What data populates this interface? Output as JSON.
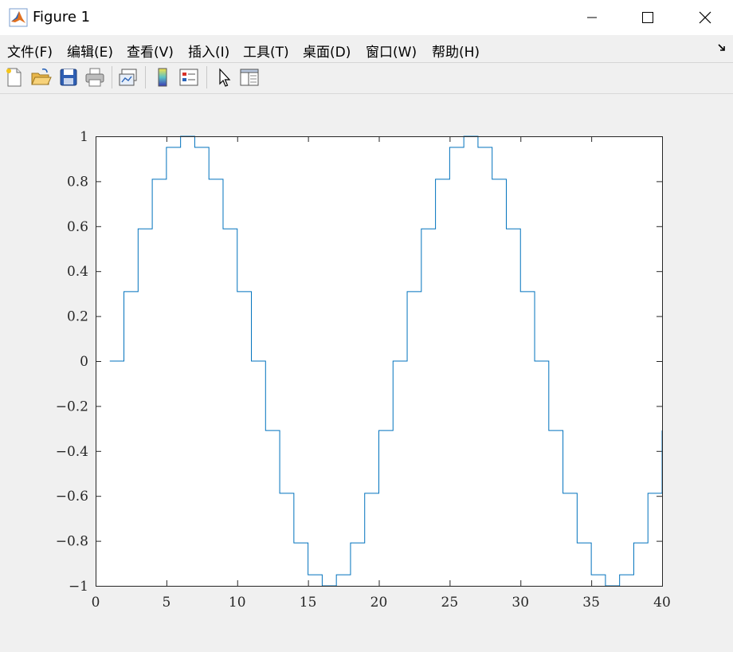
{
  "window": {
    "title": "Figure 1",
    "controls": [
      "minimize",
      "maximize",
      "close"
    ]
  },
  "menu": {
    "items": [
      "文件(F)",
      "编辑(E)",
      "查看(V)",
      "插入(I)",
      "工具(T)",
      "桌面(D)",
      "窗口(W)",
      "帮助(H)"
    ]
  },
  "toolbar": {
    "buttons": [
      "new-figure-icon",
      "open-file-icon",
      "save-icon",
      "print-icon",
      "link-plot-icon",
      "colorbar-icon",
      "legend-icon",
      "edit-pointer-icon",
      "property-inspector-icon"
    ]
  },
  "colors": {
    "line": "#0072bd",
    "background": "#f0f0f0",
    "axes_background": "#ffffff"
  },
  "chart_data": {
    "type": "line",
    "style": "stairs",
    "x": [
      1,
      2,
      3,
      4,
      5,
      6,
      7,
      8,
      9,
      10,
      11,
      12,
      13,
      14,
      15,
      16,
      17,
      18,
      19,
      20,
      21,
      22,
      23,
      24,
      25,
      26,
      27,
      28,
      29,
      30,
      31,
      32,
      33,
      34,
      35,
      36,
      37,
      38,
      39,
      40
    ],
    "values": [
      0,
      0.309,
      0.588,
      0.809,
      0.951,
      1,
      0.951,
      0.809,
      0.588,
      0.309,
      0,
      -0.309,
      -0.588,
      -0.809,
      -0.951,
      -1,
      -0.951,
      -0.809,
      -0.588,
      -0.309,
      0,
      0.309,
      0.588,
      0.809,
      0.951,
      1,
      0.951,
      0.809,
      0.588,
      0.309,
      0,
      -0.309,
      -0.588,
      -0.809,
      -0.951,
      -1,
      -0.951,
      -0.809,
      -0.588,
      -0.309
    ],
    "xlim": [
      0,
      40
    ],
    "ylim": [
      -1,
      1
    ],
    "xticks": [
      0,
      5,
      10,
      15,
      20,
      25,
      30,
      35,
      40
    ],
    "yticks": [
      -1,
      -0.8,
      -0.6,
      -0.4,
      -0.2,
      0,
      0.2,
      0.4,
      0.6,
      0.8,
      1
    ],
    "xtick_labels": [
      "0",
      "5",
      "10",
      "15",
      "20",
      "25",
      "30",
      "35",
      "40"
    ],
    "ytick_labels": [
      "−1",
      "−0.8",
      "−0.6",
      "−0.4",
      "−0.2",
      "0",
      "0.2",
      "0.4",
      "0.6",
      "0.8",
      "1"
    ],
    "title": "",
    "xlabel": "",
    "ylabel": "",
    "grid": false
  }
}
